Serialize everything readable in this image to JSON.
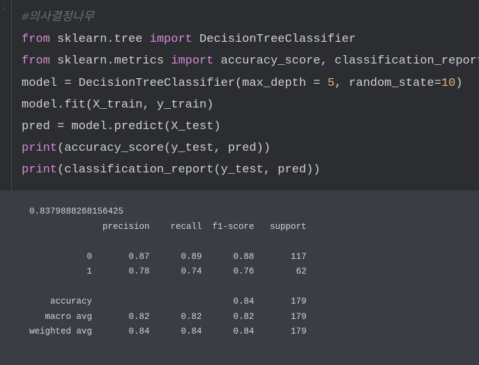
{
  "code_cell": {
    "lines": [
      [
        {
          "t": "#의사결정나무",
          "c": "cmt"
        }
      ],
      [
        {
          "t": "from",
          "c": "kw"
        },
        {
          "t": " sklearn.tree ",
          "c": ""
        },
        {
          "t": "import",
          "c": "kw"
        },
        {
          "t": " DecisionTreeClassifier",
          "c": ""
        }
      ],
      [
        {
          "t": "from",
          "c": "kw"
        },
        {
          "t": " sklearn.metrics ",
          "c": ""
        },
        {
          "t": "import",
          "c": "kw"
        },
        {
          "t": " accuracy_score, classification_report",
          "c": ""
        }
      ],
      [
        {
          "t": "model ",
          "c": ""
        },
        {
          "t": "=",
          "c": "op"
        },
        {
          "t": " DecisionTreeClassifier(max_depth ",
          "c": ""
        },
        {
          "t": "=",
          "c": "op"
        },
        {
          "t": " ",
          "c": ""
        },
        {
          "t": "5",
          "c": "num"
        },
        {
          "t": ", random_state",
          "c": ""
        },
        {
          "t": "=",
          "c": "op"
        },
        {
          "t": "10",
          "c": "num"
        },
        {
          "t": ")",
          "c": ""
        }
      ],
      [
        {
          "t": "model.fit(X_train, y_train)",
          "c": ""
        }
      ],
      [
        {
          "t": "pred ",
          "c": ""
        },
        {
          "t": "=",
          "c": "op"
        },
        {
          "t": " model.predict(X_test)",
          "c": ""
        }
      ],
      [
        {
          "t": "print",
          "c": "fn"
        },
        {
          "t": "(accuracy_score(y_test, pred))",
          "c": ""
        }
      ],
      [
        {
          "t": "print",
          "c": "fn"
        },
        {
          "t": "(classification_report(y_test, pred))",
          "c": ""
        }
      ]
    ]
  },
  "output": {
    "lines": [
      "0.8379888268156425",
      "              precision    recall  f1-score   support",
      "",
      "           0       0.87      0.89      0.88       117",
      "           1       0.78      0.74      0.76        62",
      "",
      "    accuracy                           0.84       179",
      "   macro avg       0.82      0.82      0.82       179",
      "weighted avg       0.84      0.84      0.84       179"
    ]
  },
  "colors": {
    "editor_bg": "#2b2d31",
    "output_bg": "#3a3e44",
    "keyword": "#d58bd3",
    "number": "#e5b26b",
    "comment": "#6e7076",
    "text": "#d0d0d0"
  }
}
